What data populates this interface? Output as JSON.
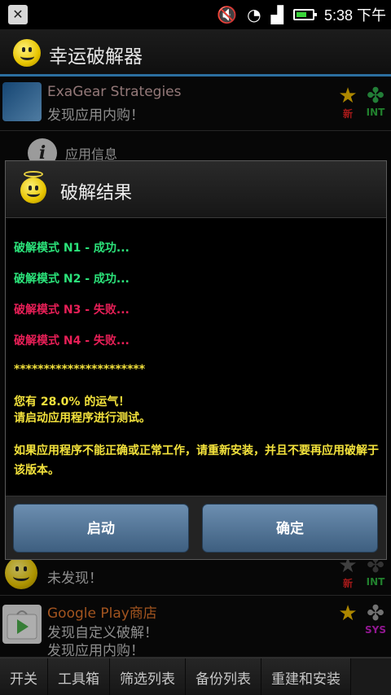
{
  "status_bar": {
    "time": "5:38 下午"
  },
  "app_bar": {
    "title": "幸运破解器"
  },
  "list": [
    {
      "title": "ExaGear Strategies",
      "sub1": "发现应用内购！",
      "badge1": "新",
      "badge2": "INT"
    },
    {
      "title": "",
      "sub1": "未发现！",
      "badge1": "新",
      "badge2": "INT"
    },
    {
      "title": "Google Play商店",
      "sub1": "发现自定义破解！",
      "sub2": "发现应用内购！",
      "badge2": "SYS"
    }
  ],
  "info_row": {
    "label": "应用信息"
  },
  "dialog": {
    "title": "破解结果",
    "lines": [
      "破解模式 N1 - 成功...",
      "破解模式 N2 - 成功...",
      "破解模式 N3 - 失败...",
      "破解模式 N4 - 失败...",
      "**********************"
    ],
    "luck_line1": "您有 28.0% 的运气！",
    "luck_line2": "请启动应用程序进行测试。",
    "advice": "如果应用程序不能正确或正常工作，请重新安装，并且不要再应用破解于该版本。",
    "launch_button": "启动",
    "ok_button": "确定"
  },
  "tabs": [
    "开关",
    "工具箱",
    "筛选列表",
    "备份列表",
    "重建和安装"
  ],
  "colors": {
    "accent": "#2c6fa0",
    "success": "#2be37a",
    "fail": "#e81f57",
    "info": "#f3e23c"
  }
}
